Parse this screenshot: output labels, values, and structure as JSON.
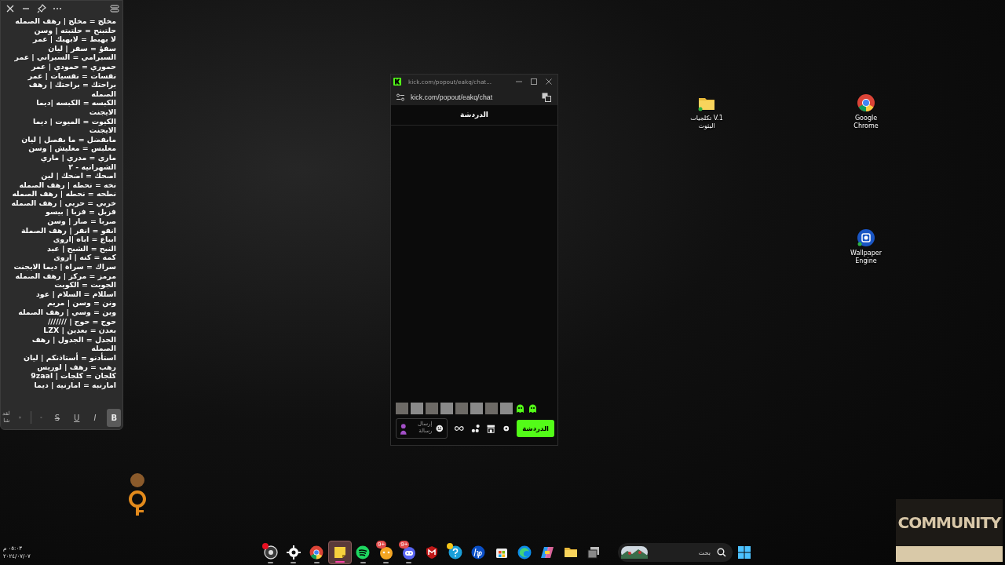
{
  "sticky_note": {
    "lines": [
      "مخلج = مخلج | رهف الصمله",
      "حلتبنح = حلتبته | وسن",
      "لا بهبط = لابهبك | عمر",
      "سفؤ = سفر | ليان",
      "السبرامي = السبراني | عمر",
      "حموري = حمودي | عمر",
      "نفسات = نفسيات | عمر",
      "براحتك = براحتك | رهف الصمله",
      "الكبسه = الكبسه |ديما الايجنت",
      "الكيوت = الميوت | ديما الايجنت",
      "مابفضل = ما بفصل | ليان",
      "معلبس = معليش | وسن",
      "ماري = مدري | ماري الشهرانيه - ٢",
      "اصحك = اضحك | لين",
      "نخه = نحطه | رهف الصمله",
      "نطحه = نحطه | رهف الصمله",
      "خربي = حربي | رهف الصمله",
      "فزبل = فزبا | بيسو",
      "صربا = صار | وسن",
      "انفو = انفر | رهف الصملة",
      "ابباع = اباه |اروى",
      "النبح = الشبح | عبد",
      "كمه = كنه | اروى",
      "سراك = سراة | ديما الايجنت",
      "مرمز = مركز | رهف الصمله",
      "الجويت = الكويت",
      "اسللام = السلام | عود",
      "ونن = وسن | مريم",
      "وبن = وسي | رهف الصمله",
      "حوح = حوج | ///////",
      "بعدن = بعدين | LZX",
      "الجدل = الجدول | رهف الصمله",
      "استأدنو = أستاذنكم | ليان",
      "رهب = رهف | لوريس",
      "كلجان = كلجات | 9zaal",
      "امارنبه = امارنيه | ديما"
    ],
    "format_buttons": [
      {
        "label": "B",
        "kind": "bold",
        "selected": true
      },
      {
        "label": "I",
        "kind": "italic",
        "selected": false
      },
      {
        "label": "U",
        "kind": "underline",
        "selected": false
      },
      {
        "label": "S",
        "kind": "strike",
        "selected": false
      }
    ],
    "side_text": "لقد شا"
  },
  "chat_window": {
    "title": "kick.com/popout/eakq/chat...",
    "url": "kick.com/popout/eakq/chat",
    "header": "الدردشة",
    "emotes": [
      {
        "kind": "photo"
      },
      {
        "kind": "photo"
      },
      {
        "kind": "photo"
      },
      {
        "kind": "photo"
      },
      {
        "kind": "photo"
      },
      {
        "kind": "photo"
      },
      {
        "kind": "photo"
      },
      {
        "kind": "photo"
      },
      {
        "kind": "face"
      },
      {
        "kind": "face"
      }
    ],
    "message_placeholder": "إرسال رسالة",
    "send_button": "الدردشة"
  },
  "desktop_icons": [
    {
      "label": "Google Chrome",
      "kind": "browser"
    },
    {
      "label": "تكلجيات V.1 البثوث",
      "kind": "folder"
    },
    {
      "label": "Wallpaper Engine",
      "kind": "wallpaper"
    }
  ],
  "wallpaper_text": "COMMUNITY",
  "clock": {
    "time": "٠٥:٠٣ م",
    "date": "٢٠٢٤/٠٧/٠٧"
  },
  "taskbar": {
    "apps": [
      {
        "kind": "windows",
        "selected": false,
        "running": false
      },
      {
        "kind": "folder",
        "selected": false,
        "running": false
      },
      {
        "kind": "copilot",
        "selected": false,
        "running": false
      },
      {
        "kind": "edge",
        "selected": false,
        "running": false
      },
      {
        "kind": "store",
        "selected": false,
        "running": false
      },
      {
        "kind": "hp",
        "selected": false,
        "running": false
      },
      {
        "kind": "help",
        "selected": false,
        "running": false,
        "color": "#f5c518"
      },
      {
        "kind": "shield",
        "selected": false,
        "running": false
      },
      {
        "kind": "game",
        "selected": false,
        "running": true,
        "badge": "9+"
      },
      {
        "kind": "chat",
        "selected": false,
        "running": true,
        "badge": "9+"
      },
      {
        "kind": "music",
        "selected": false,
        "running": true
      },
      {
        "kind": "note",
        "selected": true,
        "running": true
      },
      {
        "kind": "browser",
        "selected": false,
        "running": true
      },
      {
        "kind": "gear",
        "selected": false,
        "running": true
      },
      {
        "kind": "recorder",
        "selected": false,
        "running": true,
        "color": "#e81123"
      }
    ],
    "search_placeholder": "بحث"
  }
}
